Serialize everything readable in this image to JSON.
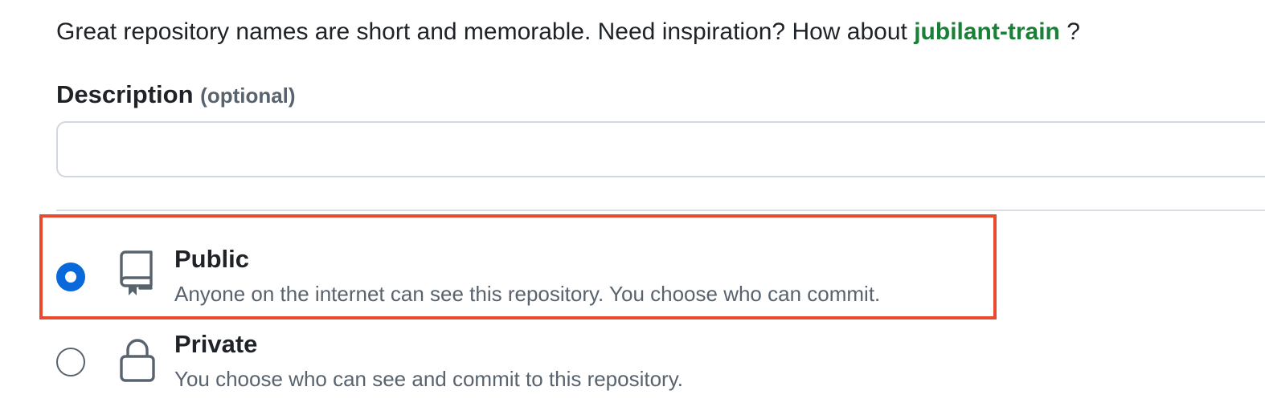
{
  "name_hint": {
    "text": "Great repository names are short and memorable. Need inspiration? How about ",
    "suggestion": "jubilant-train",
    "suffix": " ?"
  },
  "description": {
    "label": "Description",
    "optional": "(optional)",
    "value": "",
    "placeholder": ""
  },
  "visibility": {
    "selected": "public",
    "options": [
      {
        "key": "public",
        "title": "Public",
        "description": "Anyone on the internet can see this repository. You choose who can commit.",
        "icon": "repo-icon",
        "checked": true
      },
      {
        "key": "private",
        "title": "Private",
        "description": "You choose who can see and commit to this repository.",
        "icon": "lock-icon",
        "checked": false
      }
    ]
  },
  "colors": {
    "suggestion": "#1a7f37",
    "radio_selected": "#0969da",
    "highlight_box": "#e84a2f",
    "muted_text": "#59636e"
  }
}
